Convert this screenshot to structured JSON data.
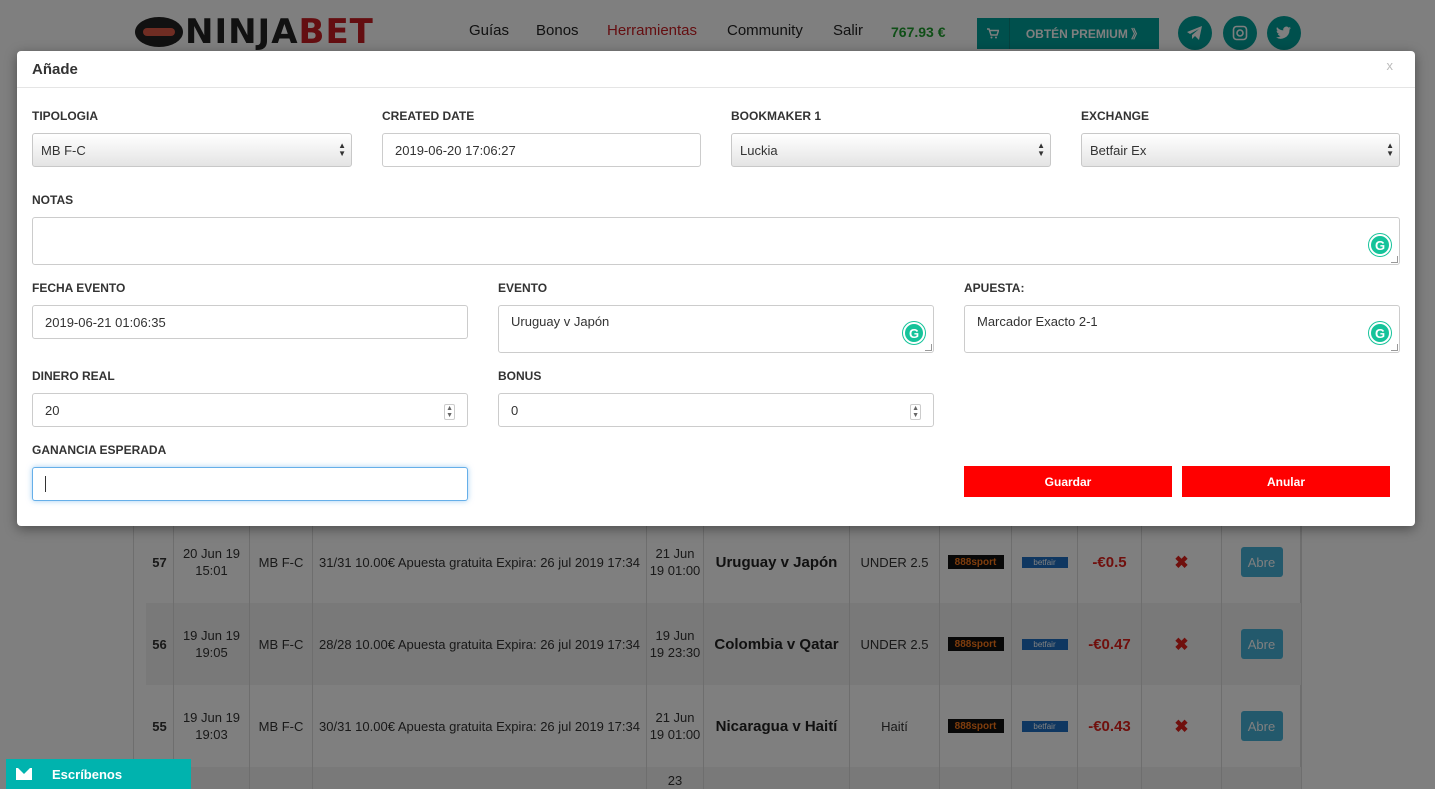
{
  "header": {
    "logo_ninja": "NINJA",
    "logo_bet": "BET",
    "nav": [
      {
        "label": "Guías",
        "active": false
      },
      {
        "label": "Bonos",
        "active": false
      },
      {
        "label": "Herramientas",
        "active": true
      },
      {
        "label": "Community",
        "active": false
      },
      {
        "label": "Salir",
        "active": false
      }
    ],
    "balance": "767.93 €",
    "cart_icon": "cart-icon",
    "premium_label": "OBTÉN PREMIUM 》",
    "social": [
      "telegram-icon",
      "instagram-icon",
      "twitter-icon"
    ]
  },
  "table": {
    "rows": [
      {
        "id": "57",
        "date": "20 Jun 19 15:01",
        "type": "MB F-C",
        "note": "31/31 10.00€ Apuesta gratuita Expira: 26 jul 2019 17:34",
        "event_date": "21 Jun 19 01:00",
        "event": "Uruguay v Japón",
        "bet": "UNDER 2.5",
        "bookmaker": "888sport",
        "exchange": "betfair",
        "profit": "-€0.5",
        "open_label": "Abre"
      },
      {
        "id": "56",
        "date": "19 Jun 19 19:05",
        "type": "MB F-C",
        "note": "28/28 10.00€ Apuesta gratuita Expira: 26 jul 2019 17:34",
        "event_date": "19 Jun 19 23:30",
        "event": "Colombia v Qatar",
        "bet": "UNDER 2.5",
        "bookmaker": "888sport",
        "exchange": "betfair",
        "profit": "-€0.47",
        "open_label": "Abre"
      },
      {
        "id": "55",
        "date": "19 Jun 19 19:03",
        "type": "MB F-C",
        "note": "30/31 10.00€ Apuesta gratuita Expira: 26 jul 2019 17:34",
        "event_date": "21 Jun 19 01:00",
        "event": "Nicaragua v Haití",
        "bet": "Haití",
        "bookmaker": "888sport",
        "exchange": "betfair",
        "profit": "-€0.43",
        "open_label": "Abre"
      }
    ],
    "partial_row_event_date": "23"
  },
  "chat": {
    "label": "Escríbenos"
  },
  "modal": {
    "title": "Añade",
    "close": "x",
    "tipologia": {
      "label": "TIPOLOGIA",
      "value": "MB F-C"
    },
    "created_date": {
      "label": "CREATED DATE",
      "value": "2019-06-20 17:06:27"
    },
    "bookmaker1": {
      "label": "BOOKMAKER 1",
      "value": "Luckia"
    },
    "exchange": {
      "label": "EXCHANGE",
      "value": "Betfair Ex"
    },
    "notas": {
      "label": "NOTAS",
      "value": ""
    },
    "fecha_evento": {
      "label": "FECHA EVENTO",
      "value": "2019-06-21 01:06:35"
    },
    "evento": {
      "label": "EVENTO",
      "value": "Uruguay v Japón"
    },
    "apuesta": {
      "label": "APUESTA:",
      "value": "Marcador Exacto 2-1"
    },
    "dinero_real": {
      "label": "DINERO REAL",
      "value": "20"
    },
    "bonus": {
      "label": "BONUS",
      "value": "0"
    },
    "ganancia": {
      "label": "GANANCIA ESPERADA",
      "value": ""
    },
    "save_label": "Guardar",
    "cancel_label": "Anular"
  },
  "colors": {
    "accent": "#00a19a",
    "brand_red": "#c91d22",
    "button_red": "#ff0000",
    "balance_green": "#1e9e2e"
  }
}
